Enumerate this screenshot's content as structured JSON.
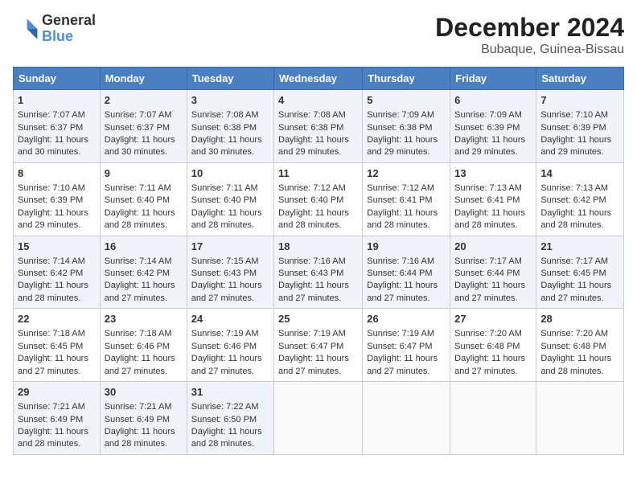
{
  "header": {
    "logo_line1": "General",
    "logo_line2": "Blue",
    "title": "December 2024",
    "subtitle": "Bubaque, Guinea-Bissau"
  },
  "days_of_week": [
    "Sunday",
    "Monday",
    "Tuesday",
    "Wednesday",
    "Thursday",
    "Friday",
    "Saturday"
  ],
  "weeks": [
    [
      {
        "day": "1",
        "sunrise": "7:07 AM",
        "sunset": "6:37 PM",
        "daylight": "11 hours and 30 minutes."
      },
      {
        "day": "2",
        "sunrise": "7:07 AM",
        "sunset": "6:37 PM",
        "daylight": "11 hours and 30 minutes."
      },
      {
        "day": "3",
        "sunrise": "7:08 AM",
        "sunset": "6:38 PM",
        "daylight": "11 hours and 30 minutes."
      },
      {
        "day": "4",
        "sunrise": "7:08 AM",
        "sunset": "6:38 PM",
        "daylight": "11 hours and 29 minutes."
      },
      {
        "day": "5",
        "sunrise": "7:09 AM",
        "sunset": "6:38 PM",
        "daylight": "11 hours and 29 minutes."
      },
      {
        "day": "6",
        "sunrise": "7:09 AM",
        "sunset": "6:39 PM",
        "daylight": "11 hours and 29 minutes."
      },
      {
        "day": "7",
        "sunrise": "7:10 AM",
        "sunset": "6:39 PM",
        "daylight": "11 hours and 29 minutes."
      }
    ],
    [
      {
        "day": "8",
        "sunrise": "7:10 AM",
        "sunset": "6:39 PM",
        "daylight": "11 hours and 29 minutes."
      },
      {
        "day": "9",
        "sunrise": "7:11 AM",
        "sunset": "6:40 PM",
        "daylight": "11 hours and 28 minutes."
      },
      {
        "day": "10",
        "sunrise": "7:11 AM",
        "sunset": "6:40 PM",
        "daylight": "11 hours and 28 minutes."
      },
      {
        "day": "11",
        "sunrise": "7:12 AM",
        "sunset": "6:40 PM",
        "daylight": "11 hours and 28 minutes."
      },
      {
        "day": "12",
        "sunrise": "7:12 AM",
        "sunset": "6:41 PM",
        "daylight": "11 hours and 28 minutes."
      },
      {
        "day": "13",
        "sunrise": "7:13 AM",
        "sunset": "6:41 PM",
        "daylight": "11 hours and 28 minutes."
      },
      {
        "day": "14",
        "sunrise": "7:13 AM",
        "sunset": "6:42 PM",
        "daylight": "11 hours and 28 minutes."
      }
    ],
    [
      {
        "day": "15",
        "sunrise": "7:14 AM",
        "sunset": "6:42 PM",
        "daylight": "11 hours and 28 minutes."
      },
      {
        "day": "16",
        "sunrise": "7:14 AM",
        "sunset": "6:42 PM",
        "daylight": "11 hours and 27 minutes."
      },
      {
        "day": "17",
        "sunrise": "7:15 AM",
        "sunset": "6:43 PM",
        "daylight": "11 hours and 27 minutes."
      },
      {
        "day": "18",
        "sunrise": "7:16 AM",
        "sunset": "6:43 PM",
        "daylight": "11 hours and 27 minutes."
      },
      {
        "day": "19",
        "sunrise": "7:16 AM",
        "sunset": "6:44 PM",
        "daylight": "11 hours and 27 minutes."
      },
      {
        "day": "20",
        "sunrise": "7:17 AM",
        "sunset": "6:44 PM",
        "daylight": "11 hours and 27 minutes."
      },
      {
        "day": "21",
        "sunrise": "7:17 AM",
        "sunset": "6:45 PM",
        "daylight": "11 hours and 27 minutes."
      }
    ],
    [
      {
        "day": "22",
        "sunrise": "7:18 AM",
        "sunset": "6:45 PM",
        "daylight": "11 hours and 27 minutes."
      },
      {
        "day": "23",
        "sunrise": "7:18 AM",
        "sunset": "6:46 PM",
        "daylight": "11 hours and 27 minutes."
      },
      {
        "day": "24",
        "sunrise": "7:19 AM",
        "sunset": "6:46 PM",
        "daylight": "11 hours and 27 minutes."
      },
      {
        "day": "25",
        "sunrise": "7:19 AM",
        "sunset": "6:47 PM",
        "daylight": "11 hours and 27 minutes."
      },
      {
        "day": "26",
        "sunrise": "7:19 AM",
        "sunset": "6:47 PM",
        "daylight": "11 hours and 27 minutes."
      },
      {
        "day": "27",
        "sunrise": "7:20 AM",
        "sunset": "6:48 PM",
        "daylight": "11 hours and 27 minutes."
      },
      {
        "day": "28",
        "sunrise": "7:20 AM",
        "sunset": "6:48 PM",
        "daylight": "11 hours and 28 minutes."
      }
    ],
    [
      {
        "day": "29",
        "sunrise": "7:21 AM",
        "sunset": "6:49 PM",
        "daylight": "11 hours and 28 minutes."
      },
      {
        "day": "30",
        "sunrise": "7:21 AM",
        "sunset": "6:49 PM",
        "daylight": "11 hours and 28 minutes."
      },
      {
        "day": "31",
        "sunrise": "7:22 AM",
        "sunset": "6:50 PM",
        "daylight": "11 hours and 28 minutes."
      },
      null,
      null,
      null,
      null
    ]
  ]
}
